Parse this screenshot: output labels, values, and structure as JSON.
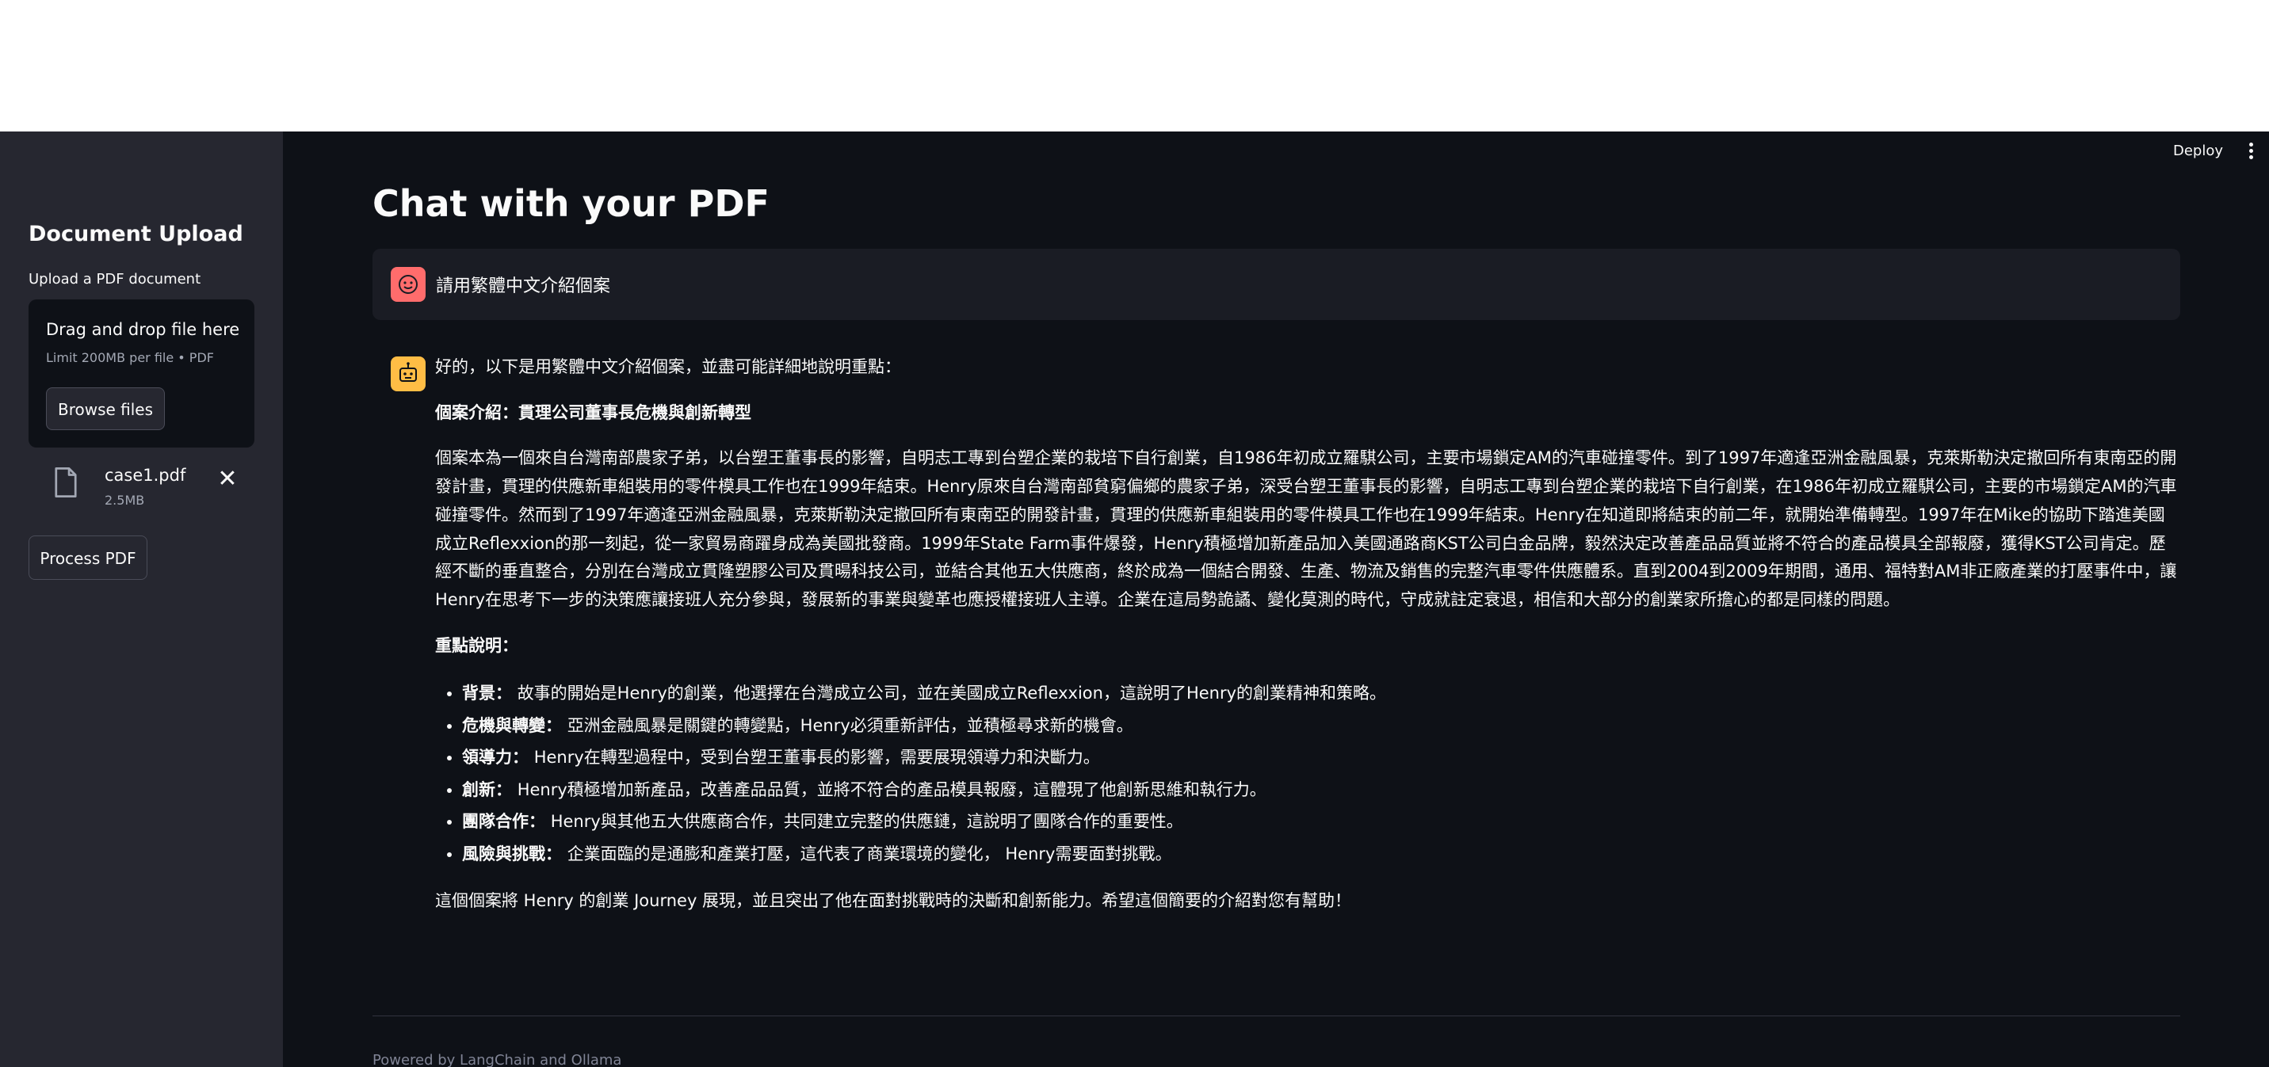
{
  "sidebar": {
    "title": "Document Upload",
    "upload_label": "Upload a PDF document",
    "dropzone": {
      "title": "Drag and drop file here",
      "limit": "Limit 200MB per file • PDF",
      "browse_label": "Browse files"
    },
    "file": {
      "name": "case1.pdf",
      "size": "2.5MB"
    },
    "process_label": "Process PDF"
  },
  "header": {
    "deploy_label": "Deploy"
  },
  "main": {
    "title": "Chat with your PDF",
    "user_message": "請用繁體中文介紹個案",
    "assistant": {
      "intro": "好的，以下是用繁體中文介紹個案，並盡可能詳細地說明重點：",
      "case_heading": "個案介紹：貫理公司董事長危機與創新轉型",
      "case_body": "個案本為一個來自台灣南部農家子弟，以台塑王董事長的影響，自明志工專到台塑企業的栽培下自行創業，自1986年初成立羅騏公司，主要市場鎖定AM的汽車碰撞零件。到了1997年適逢亞洲金融風暴，克萊斯勒決定撤回所有東南亞的開發計畫，貫理的供應新車組裝用的零件模具工作也在1999年結束。Henry原來自台灣南部貧窮偏鄉的農家子弟，深受台塑王董事長的影響，自明志工專到台塑企業的栽培下自行創業，在1986年初成立羅騏公司，主要的市場鎖定AM的汽車碰撞零件。然而到了1997年適逢亞洲金融風暴，克萊斯勒決定撤回所有東南亞的開發計畫，貫理的供應新車組裝用的零件模具工作也在1999年結束。Henry在知道即將結束的前二年，就開始準備轉型。1997年在Mike的協助下踏進美國成立Reflexxion的那一刻起，從一家貿易商躍身成為美國批發商。1999年State Farm事件爆發，Henry積極增加新產品加入美國通路商KST公司白金品牌，毅然決定改善產品品質並將不符合的產品模具全部報廢，獲得KST公司肯定。歷經不斷的垂直整合，分別在台灣成立貫隆塑膠公司及貫暘科技公司，並結合其他五大供應商，終於成為一個結合開發、生產、物流及銷售的完整汽車零件供應體系。直到2004到2009年期間，通用、福特對AM非正廠產業的打壓事件中，讓Henry在思考下一步的決策應讓接班人充分參與，發展新的事業與變革也應授權接班人主導。企業在這局勢詭譎、變化莫測的時代，守成就註定衰退，相信和大部分的創業家所擔心的都是同樣的問題。",
      "points_heading": "重點說明：",
      "points": [
        {
          "label": "背景：",
          "text": "故事的開始是Henry的創業，他選擇在台灣成立公司，並在美國成立Reflexxion，這說明了Henry的創業精神和策略。"
        },
        {
          "label": "危機與轉變：",
          "text": "亞洲金融風暴是關鍵的轉變點，Henry必須重新評估，並積極尋求新的機會。"
        },
        {
          "label": "領導力：",
          "text": "Henry在轉型過程中，受到台塑王董事長的影響，需要展現領導力和決斷力。"
        },
        {
          "label": "創新：",
          "text": "Henry積極增加新產品，改善產品品質，並將不符合的產品模具報廢，這體現了他創新思維和執行力。"
        },
        {
          "label": "團隊合作：",
          "text": "Henry與其他五大供應商合作，共同建立完整的供應鏈，這說明了團隊合作的重要性。"
        },
        {
          "label": "風險與挑戰：",
          "text": "企業面臨的是通膨和產業打壓，這代表了商業環境的變化， Henry需要面對挑戰。"
        }
      ],
      "conclusion": "這個個案將 Henry 的創業 Journey 展現，並且突出了他在面對挑戰時的決斷和創新能力。希望這個簡要的介紹對您有幫助！"
    },
    "footer": "Powered by LangChain and Ollama"
  },
  "colors": {
    "sidebar_bg": "#262730",
    "main_bg": "#0e1117",
    "user_avatar": "#ff6c6c",
    "assistant_avatar": "#ffbd45"
  },
  "icons": [
    "file-icon",
    "close-icon",
    "more-vertical-icon",
    "user-face-icon",
    "robot-icon"
  ]
}
